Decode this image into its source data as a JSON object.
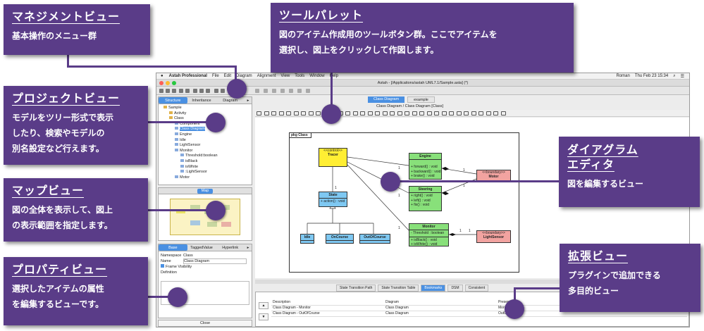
{
  "callouts": {
    "management": {
      "title": "マネジメントビュー",
      "body": "基本操作のメニュー群"
    },
    "palette": {
      "title": "ツールパレット",
      "body": "図のアイテム作成用のツールボタン群。ここでアイテムを\n選択し、図上をクリックして作図します。"
    },
    "project": {
      "title": "プロジェクトビュー",
      "body": "モデルをツリー形式で表示\nしたり、検索やモデルの\n別名設定など行えます。"
    },
    "map": {
      "title": "マップビュー",
      "body": "図の全体を表示して、図上\nの表示範囲を指定します。"
    },
    "property": {
      "title": "プロパティビュー",
      "body": "選択したアイテムの属性\nを編集するビューです。"
    },
    "diagram_editor": {
      "title": "ダイアグラム\nエディタ",
      "body": "図を編集するビュー"
    },
    "extension": {
      "title": "拡張ビュー",
      "body": "プラグインで追加できる\n多目的ビュー"
    }
  },
  "app": {
    "menu": [
      "Astah Professional",
      "File",
      "Edit",
      "Diagram",
      "Alignment",
      "View",
      "Tools",
      "Window",
      "Help"
    ],
    "status": [
      "Roman",
      "Thu Feb 23  15:34"
    ],
    "title": "Astah - [/Applications/astah UML7.1/Sample.asta] (*)",
    "structure_tabs": [
      "Structure",
      "Inheritance",
      "Diagram"
    ],
    "tree": [
      {
        "label": "Sample",
        "level": 0
      },
      {
        "label": "Activity",
        "level": 1
      },
      {
        "label": "Class",
        "level": 1
      },
      {
        "label": "Component",
        "level": 2
      },
      {
        "label": "Class Diagram",
        "level": 2,
        "selected": true
      },
      {
        "label": "Engine",
        "level": 2
      },
      {
        "label": "Idle",
        "level": 2
      },
      {
        "label": "LightSensor",
        "level": 2
      },
      {
        "label": "Monitor",
        "level": 2
      },
      {
        "label": "Threshold:boolean",
        "level": 3
      },
      {
        "label": "isBlack",
        "level": 3
      },
      {
        "label": "isWhite",
        "level": 3
      },
      {
        "label": ":LightSensor",
        "level": 3
      },
      {
        "label": "Motor",
        "level": 2
      }
    ],
    "map_tab": "Map",
    "prop_tabs": [
      "Base",
      "TaggedValue",
      "Hyperlink"
    ],
    "namespace_label": "Namespace",
    "namespace_value": "Class",
    "name_label": "Name",
    "name_value": "Class Diagram",
    "frame_visibility": "Frame Visibility",
    "definition_label": "Definition",
    "close_button": "Close",
    "doc_tabs": [
      "Class Diagram",
      "example"
    ],
    "breadcrumb": "Class Diagram / Class Diagram [Class]",
    "frame_label": "pkg Class",
    "diagram": {
      "tracer": {
        "stereo": "<<control>>",
        "name": "Tracer"
      },
      "engine": {
        "name": "Engine",
        "ops": "+ forward() : void\n+ backward() : void\n+ brake() : void"
      },
      "motor": {
        "stereo": "<<boundary>>",
        "name": "Motor"
      },
      "state": {
        "name": "State",
        "ops": "+ action() : void"
      },
      "steering": {
        "name": "Steering",
        "ops": "+ right() : void\n+ left() : void\n+ fix() : void"
      },
      "monitor": {
        "name": "Monitor",
        "attrs": "- Threshold : boolean",
        "ops": "+ isBlack() : void\n+ isWhite() : void"
      },
      "lightsensor": {
        "stereo": "<<boundary>>",
        "name": "LightSensor"
      },
      "idle": {
        "name": "Idle"
      },
      "oncourse": {
        "name": "OnCourse"
      },
      "offcourse": {
        "name": "OutOfCourse"
      },
      "mult": [
        "1",
        "1",
        "1",
        "1",
        "1",
        "1",
        "1",
        "1"
      ]
    },
    "ext_tabs": [
      "State Transition Path",
      "State Transition Table",
      "Bookmarks",
      "DSM",
      "Consistent"
    ],
    "ext_active": "Bookmarks",
    "bookmark_headers": [
      "Description",
      "Diagram",
      "Presentation"
    ],
    "bookmark_rows": [
      [
        "Class Diagram - Monitor",
        "Class Diagram",
        "Monitor"
      ],
      [
        "Class Diagram - OutOfCourse",
        "Class Diagram",
        "OutOfCourse"
      ]
    ]
  },
  "colors": {
    "callout": "#5a3c88",
    "class_fill": "#88e07a",
    "control_fill": "#ffee33",
    "boundary_fill": "#f2a3a0",
    "state_fill": "#7ec8f2",
    "selection": "#4a90e2"
  }
}
